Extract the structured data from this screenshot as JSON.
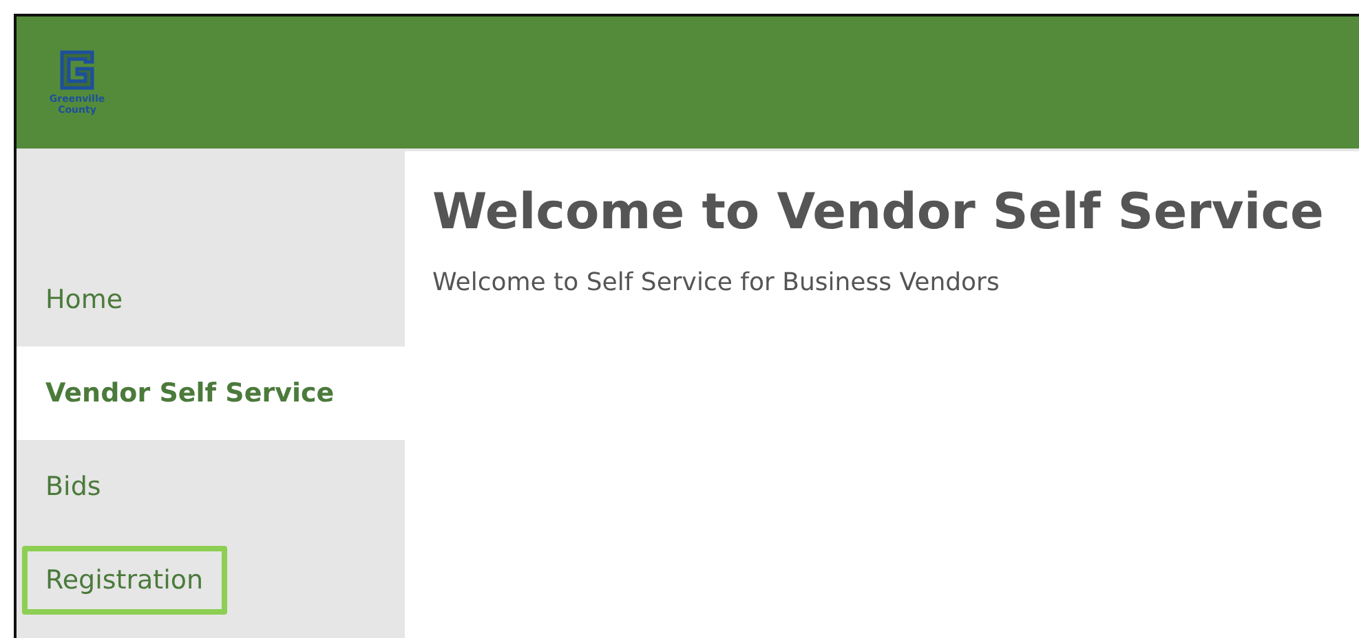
{
  "header": {
    "logo_text": "Greenville County"
  },
  "sidebar": {
    "items": [
      {
        "label": "Home",
        "selected": false,
        "highlighted": false
      },
      {
        "label": "Vendor Self Service",
        "selected": true,
        "highlighted": false
      },
      {
        "label": "Bids",
        "selected": false,
        "highlighted": false
      },
      {
        "label": "Registration",
        "selected": false,
        "highlighted": true
      }
    ]
  },
  "main": {
    "title": "Welcome to Vendor Self Service",
    "subtitle": "Welcome to Self Service for Business Vendors"
  }
}
